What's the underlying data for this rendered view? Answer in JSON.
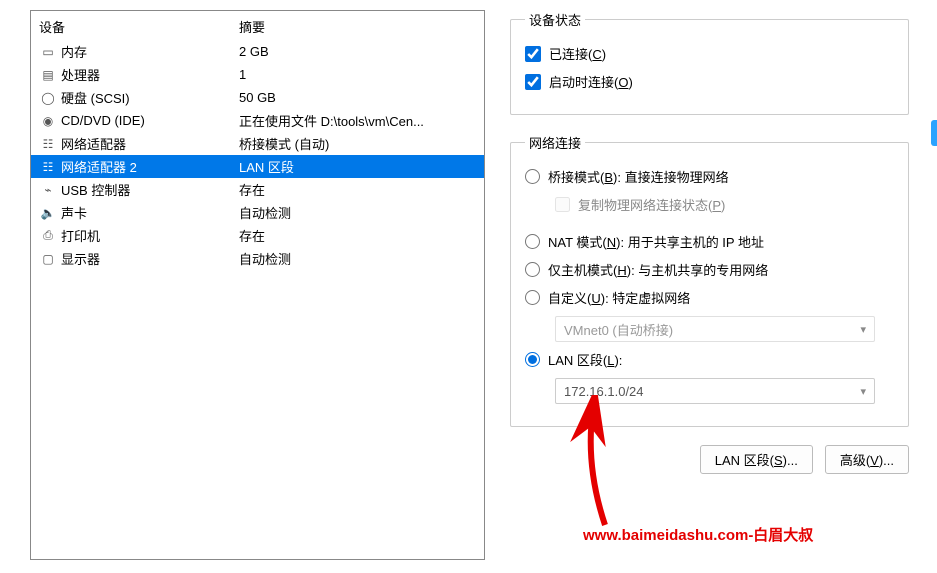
{
  "left": {
    "header_device": "设备",
    "header_summary": "摘要",
    "rows": [
      {
        "icon": "memory-icon",
        "label": "内存",
        "summary": "2 GB"
      },
      {
        "icon": "cpu-icon",
        "label": "处理器",
        "summary": "1"
      },
      {
        "icon": "disk-icon",
        "label": "硬盘 (SCSI)",
        "summary": "50 GB"
      },
      {
        "icon": "cd-icon",
        "label": "CD/DVD (IDE)",
        "summary": "正在使用文件 D:\\tools\\vm\\Cen..."
      },
      {
        "icon": "net-icon",
        "label": "网络适配器",
        "summary": "桥接模式 (自动)"
      },
      {
        "icon": "net-icon",
        "label": "网络适配器 2",
        "summary": "LAN 区段",
        "selected": true
      },
      {
        "icon": "usb-icon",
        "label": "USB 控制器",
        "summary": "存在"
      },
      {
        "icon": "sound-icon",
        "label": "声卡",
        "summary": "自动检测"
      },
      {
        "icon": "printer-icon",
        "label": "打印机",
        "summary": "存在"
      },
      {
        "icon": "display-icon",
        "label": "显示器",
        "summary": "自动检测"
      }
    ]
  },
  "status": {
    "legend": "设备状态",
    "connected_pre": "已连接(",
    "connected_u": "C",
    "connected_post": ")",
    "connect_on_pre": "启动时连接(",
    "connect_on_u": "O",
    "connect_on_post": ")"
  },
  "network": {
    "legend": "网络连接",
    "bridged_pre": "桥接模式(",
    "bridged_u": "B",
    "bridged_post": "): 直接连接物理网络",
    "replicate_pre": "复制物理网络连接状态(",
    "replicate_u": "P",
    "replicate_post": ")",
    "nat_pre": "NAT 模式(",
    "nat_u": "N",
    "nat_post": "): 用于共享主机的 IP 地址",
    "hostonly_pre": "仅主机模式(",
    "hostonly_u": "H",
    "hostonly_post": "): 与主机共享的专用网络",
    "custom_pre": "自定义(",
    "custom_u": "U",
    "custom_post": "): 特定虚拟网络",
    "vmnet_value": "VMnet0 (自动桥接)",
    "lanseg_pre": "LAN 区段(",
    "lanseg_u": "L",
    "lanseg_post": "):",
    "lanseg_value": "172.16.1.0/24"
  },
  "buttons": {
    "lanseg_btn_pre": "LAN 区段(",
    "lanseg_btn_u": "S",
    "lanseg_btn_post": ")...",
    "advanced_pre": "高级(",
    "advanced_u": "V",
    "advanced_post": ")..."
  },
  "watermark": "www.baimeidashu.com-白眉大叔"
}
